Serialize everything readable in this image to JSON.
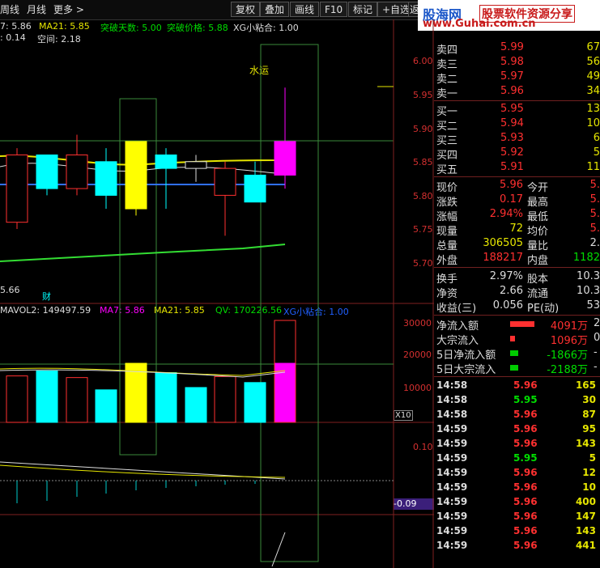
{
  "toolbar": {
    "period_week": "周线",
    "period_month": "月线",
    "more": "更多 >",
    "buttons": [
      "复权",
      "叠加",
      "画线",
      "F10",
      "标记",
      "+自选",
      "返"
    ]
  },
  "watermark": {
    "logo": "股海网",
    "tagline": "股票软件资源分享",
    "url": "www.Guhai.com.cn"
  },
  "indicators": {
    "line1": {
      "ma7": "7: 5.86",
      "ma21": "MA21: 5.85",
      "break_days": "突破天数: 5.00",
      "break_price": "突破价格: 5.88",
      "xg": "XG小粘合: 1.00"
    },
    "line2": {
      "a": ": 0.14",
      "gap": "空间: 2.18"
    },
    "label_shuiyun": "水运",
    "low_price": "5.66",
    "cai": "财",
    "volume_line": {
      "mavol2": "MAVOL2: 149497.59",
      "ma7": "MA7: 5.86",
      "ma21": "MA21: 5.85",
      "qv": "QV: 170226.56",
      "xg": "XG小粘合: 1.00"
    },
    "x10": "X10",
    "osc_value": "-0.09"
  },
  "price_axis": [
    "6.00",
    "5.95",
    "5.90",
    "5.85",
    "5.80",
    "5.75",
    "5.70"
  ],
  "volume_axis": [
    "30000",
    "20000",
    "10000"
  ],
  "osc_axis": [
    "0.10"
  ],
  "candles": [
    {
      "o": 5.86,
      "c": 5.76,
      "h": 5.87,
      "l": 5.75,
      "fill": false,
      "col": "#ff3030"
    },
    {
      "o": 5.81,
      "c": 5.86,
      "h": 5.86,
      "l": 5.8,
      "fill": true,
      "col": "#00ffff"
    },
    {
      "o": 5.86,
      "c": 5.81,
      "h": 5.89,
      "l": 5.8,
      "fill": false,
      "col": "#ff3030"
    },
    {
      "o": 5.8,
      "c": 5.85,
      "h": 5.87,
      "l": 5.78,
      "fill": true,
      "col": "#00ffff"
    },
    {
      "o": 5.88,
      "c": 5.78,
      "h": 5.88,
      "l": 5.77,
      "fill": true,
      "col": "#ffff00"
    },
    {
      "o": 5.84,
      "c": 5.86,
      "h": 5.87,
      "l": 5.78,
      "fill": true,
      "col": "#00ffff"
    },
    {
      "o": 5.85,
      "c": 5.84,
      "h": 5.86,
      "l": 5.82,
      "fill": false,
      "col": "#ddd"
    },
    {
      "o": 5.84,
      "c": 5.8,
      "h": 5.85,
      "l": 5.74,
      "fill": false,
      "col": "#ff3030"
    },
    {
      "o": 5.79,
      "c": 5.83,
      "h": 5.85,
      "l": 5.79,
      "fill": true,
      "col": "#00ffff"
    },
    {
      "o": 5.83,
      "c": 5.88,
      "h": 5.96,
      "l": 5.81,
      "fill": true,
      "col": "#ff00ff"
    }
  ],
  "volumes": [
    {
      "v": 14000,
      "fill": false,
      "col": "#ff3030"
    },
    {
      "v": 15500,
      "fill": true,
      "col": "#00ffff"
    },
    {
      "v": 13500,
      "fill": false,
      "col": "#ff3030"
    },
    {
      "v": 9800,
      "fill": true,
      "col": "#00ffff"
    },
    {
      "v": 17800,
      "fill": true,
      "col": "#ffff00"
    },
    {
      "v": 15000,
      "fill": true,
      "col": "#00ffff"
    },
    {
      "v": 10500,
      "fill": true,
      "col": "#00ffff"
    },
    {
      "v": 13800,
      "fill": false,
      "col": "#ff3030"
    },
    {
      "v": 12000,
      "fill": true,
      "col": "#00ffff"
    },
    {
      "v": 17800,
      "fill": true,
      "col": "#ff00ff"
    }
  ],
  "quote": {
    "asks": [
      {
        "label": "卖四",
        "price": "5.99",
        "vol": "67"
      },
      {
        "label": "卖三",
        "price": "5.98",
        "vol": "56"
      },
      {
        "label": "卖二",
        "price": "5.97",
        "vol": "49"
      },
      {
        "label": "卖一",
        "price": "5.96",
        "vol": "34"
      }
    ],
    "bids": [
      {
        "label": "买一",
        "price": "5.95",
        "vol": "13"
      },
      {
        "label": "买二",
        "price": "5.94",
        "vol": "10"
      },
      {
        "label": "买三",
        "price": "5.93",
        "vol": "6"
      },
      {
        "label": "买四",
        "price": "5.92",
        "vol": "5"
      },
      {
        "label": "买五",
        "price": "5.91",
        "vol": "11"
      }
    ],
    "stats": [
      {
        "l1": "现价",
        "v1": "5.96",
        "c1": "qv",
        "l2": "今开",
        "v2": "5.",
        "c2": "qv"
      },
      {
        "l1": "涨跌",
        "v1": "0.17",
        "c1": "qv",
        "l2": "最高",
        "v2": "5.",
        "c2": "qv"
      },
      {
        "l1": "涨幅",
        "v1": "2.94%",
        "c1": "qv",
        "l2": "最低",
        "v2": "5.",
        "c2": "qv"
      },
      {
        "l1": "现量",
        "v1": "72",
        "c1": "qvy",
        "l2": "均价",
        "v2": "5.",
        "c2": "qv"
      },
      {
        "l1": "总量",
        "v1": "306505",
        "c1": "qvy",
        "l2": "量比",
        "v2": "2.",
        "c2": "qvw"
      },
      {
        "l1": "外盘",
        "v1": "188217",
        "c1": "qv",
        "l2": "内盘",
        "v2": "1182",
        "c2": "qvg"
      }
    ],
    "finance": [
      {
        "l1": "换手",
        "v1": "2.97%",
        "l2": "股本",
        "v2": "10.3"
      },
      {
        "l1": "净资",
        "v1": "2.66",
        "l2": "流通",
        "v2": "10.3"
      },
      {
        "l1": "收益(三)",
        "v1": "0.056",
        "l2": "PE(动)",
        "v2": "53"
      }
    ],
    "flows": [
      {
        "label": "净流入额",
        "val": "4091万",
        "extra": "2",
        "col": "#ff3030",
        "bar": 30
      },
      {
        "label": "大宗流入",
        "val": "1096万",
        "extra": "0",
        "col": "#ff3030",
        "bar": 6
      },
      {
        "label": "5日净流入额",
        "val": "-1866万",
        "extra": "-",
        "col": "#00cc00",
        "bar": 10
      },
      {
        "label": "5日大宗流入",
        "val": "-2188万",
        "extra": "-",
        "col": "#00cc00",
        "bar": 10
      }
    ],
    "ticks": [
      {
        "t": "14:58",
        "p": "5.96",
        "pc": "qv",
        "v": "165",
        "vc": "qvy"
      },
      {
        "t": "14:58",
        "p": "5.95",
        "pc": "qvg",
        "v": "30",
        "vc": "qvy"
      },
      {
        "t": "14:58",
        "p": "5.96",
        "pc": "qv",
        "v": "87",
        "vc": "qvy"
      },
      {
        "t": "14:59",
        "p": "5.96",
        "pc": "qv",
        "v": "95",
        "vc": "qvy"
      },
      {
        "t": "14:59",
        "p": "5.96",
        "pc": "qv",
        "v": "143",
        "vc": "qvy"
      },
      {
        "t": "14:59",
        "p": "5.95",
        "pc": "qvg",
        "v": "5",
        "vc": "qvy"
      },
      {
        "t": "14:59",
        "p": "5.96",
        "pc": "qv",
        "v": "12",
        "vc": "qvy"
      },
      {
        "t": "14:59",
        "p": "5.96",
        "pc": "qv",
        "v": "10",
        "vc": "qvy"
      },
      {
        "t": "14:59",
        "p": "5.96",
        "pc": "qv",
        "v": "400",
        "vc": "qvy"
      },
      {
        "t": "14:59",
        "p": "5.96",
        "pc": "qv",
        "v": "147",
        "vc": "qvy"
      },
      {
        "t": "14:59",
        "p": "5.96",
        "pc": "qv",
        "v": "143",
        "vc": "qvy"
      },
      {
        "t": "14:59",
        "p": "5.96",
        "pc": "qv",
        "v": "441",
        "vc": "qvy"
      }
    ]
  }
}
